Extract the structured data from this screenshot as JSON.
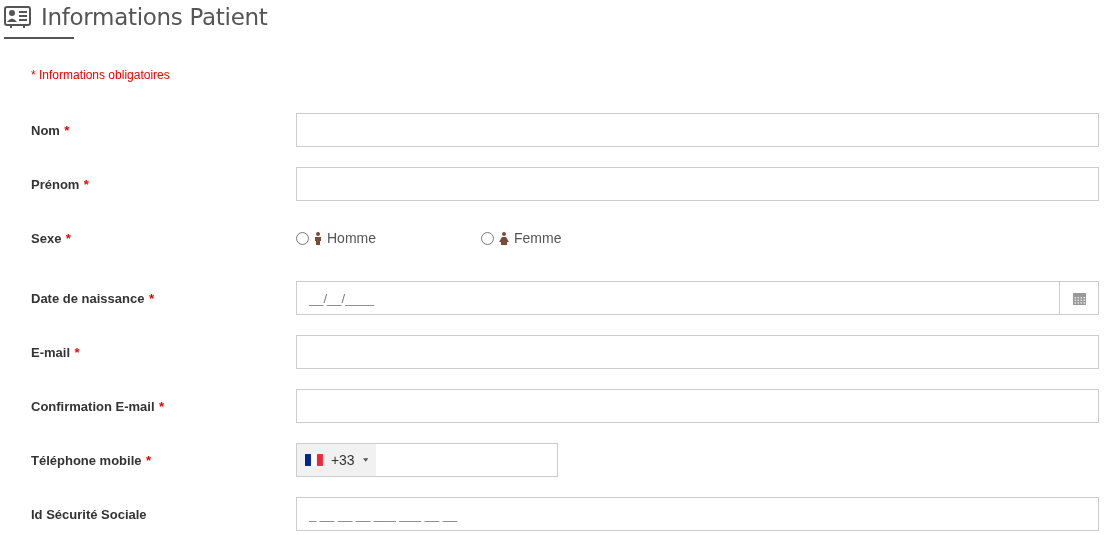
{
  "header": {
    "title": "Informations Patient"
  },
  "required_note": "* Informations obligatoires",
  "fields": [
    {
      "kind": "text",
      "label": "Nom",
      "required_mark": "*"
    },
    {
      "kind": "text",
      "label": "Prénom",
      "required_mark": "*"
    },
    {
      "kind": "radio",
      "label": "Sexe",
      "required_mark": "*",
      "options": [
        {
          "label": "Homme",
          "selected": false,
          "kind": "male"
        },
        {
          "label": "Femme",
          "selected": false,
          "kind": "female"
        }
      ]
    },
    {
      "kind": "date",
      "label": "Date de naissance",
      "required_mark": "*",
      "placeholder": "__/__/____"
    },
    {
      "kind": "text",
      "label": "E-mail",
      "required_mark": "*"
    },
    {
      "kind": "text",
      "label": "Confirmation E-mail",
      "required_mark": "*"
    },
    {
      "kind": "phone",
      "label": "Téléphone mobile",
      "required_mark": "*",
      "dial_code": "+33"
    },
    {
      "kind": "text",
      "label": "Id Sécurité Sociale",
      "placeholder": "_ __ __ __ ___ ___ __ __"
    }
  ]
}
